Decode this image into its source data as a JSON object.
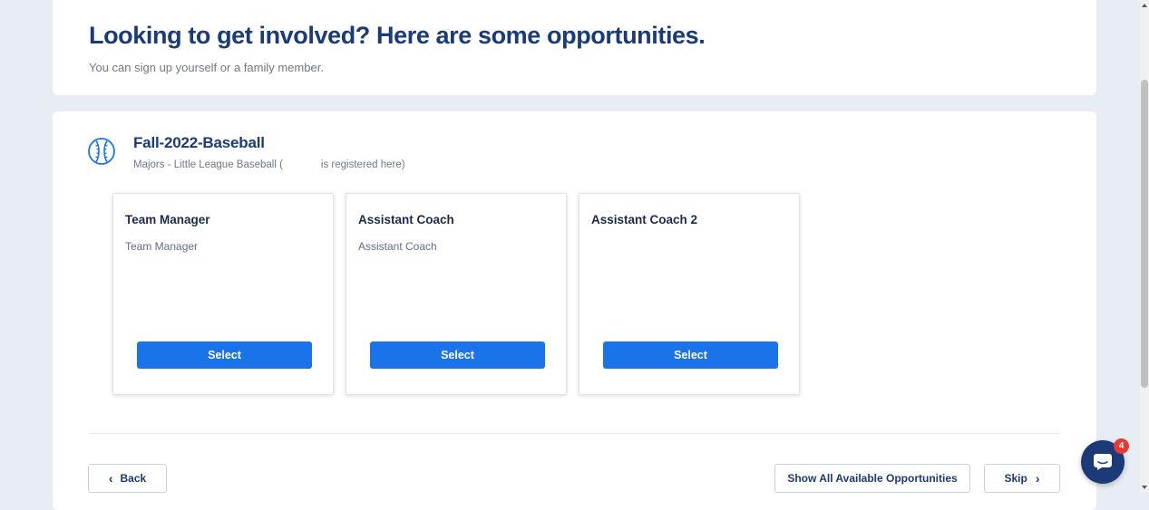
{
  "header": {
    "title": "Looking to get involved? Here are some opportunities.",
    "subtitle": "You can sign up yourself or a family member."
  },
  "program": {
    "icon": "baseball-icon",
    "title": "Fall-2022-Baseball",
    "division_prefix": "Majors - Little League Baseball (",
    "division_suffix": "is registered here)"
  },
  "opportunities": [
    {
      "title": "Team Manager",
      "description": "Team Manager",
      "button_label": "Select"
    },
    {
      "title": "Assistant Coach",
      "description": "Assistant Coach",
      "button_label": "Select"
    },
    {
      "title": "Assistant Coach 2",
      "description": "",
      "button_label": "Select"
    }
  ],
  "footer": {
    "back_label": "Back",
    "show_all_label": "Show All Available Opportunities",
    "skip_label": "Skip"
  },
  "chat": {
    "icon": "chat-bubble-icon",
    "badge_count": "4"
  },
  "colors": {
    "brand_navy": "#1b3a78",
    "primary_blue": "#1a73e8",
    "page_background": "#e8edf4",
    "badge_red": "#e53935"
  }
}
